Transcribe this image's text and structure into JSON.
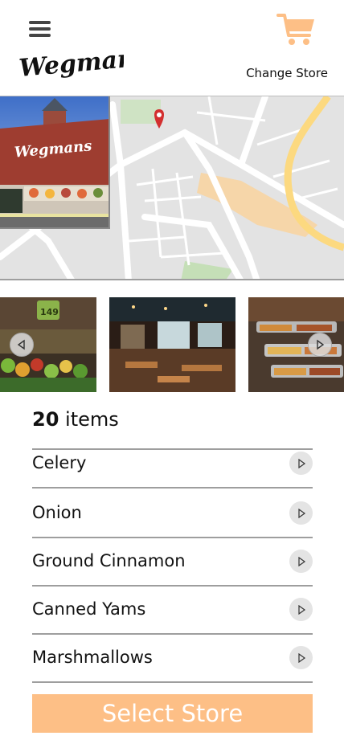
{
  "header": {
    "brand": "Wegmans",
    "change_store_label": "Change Store",
    "menu_icon": "hamburger-menu-icon",
    "cart_icon": "shopping-cart-icon",
    "accent_color": "#fdbf86"
  },
  "hero": {
    "storefront_sign": "Wegmans",
    "map_pin_color": "#d32f2f"
  },
  "gallery": {
    "images": [
      "produce-aisle",
      "cafe-seating",
      "hot-food-bar"
    ],
    "produce_sign": "149"
  },
  "items": {
    "count": "20",
    "count_suffix": "items",
    "list": [
      {
        "name": "Celery"
      },
      {
        "name": "Onion"
      },
      {
        "name": "Ground Cinnamon"
      },
      {
        "name": "Canned Yams"
      },
      {
        "name": "Marshmallows"
      }
    ]
  },
  "actions": {
    "select_store_label": "Select Store"
  }
}
